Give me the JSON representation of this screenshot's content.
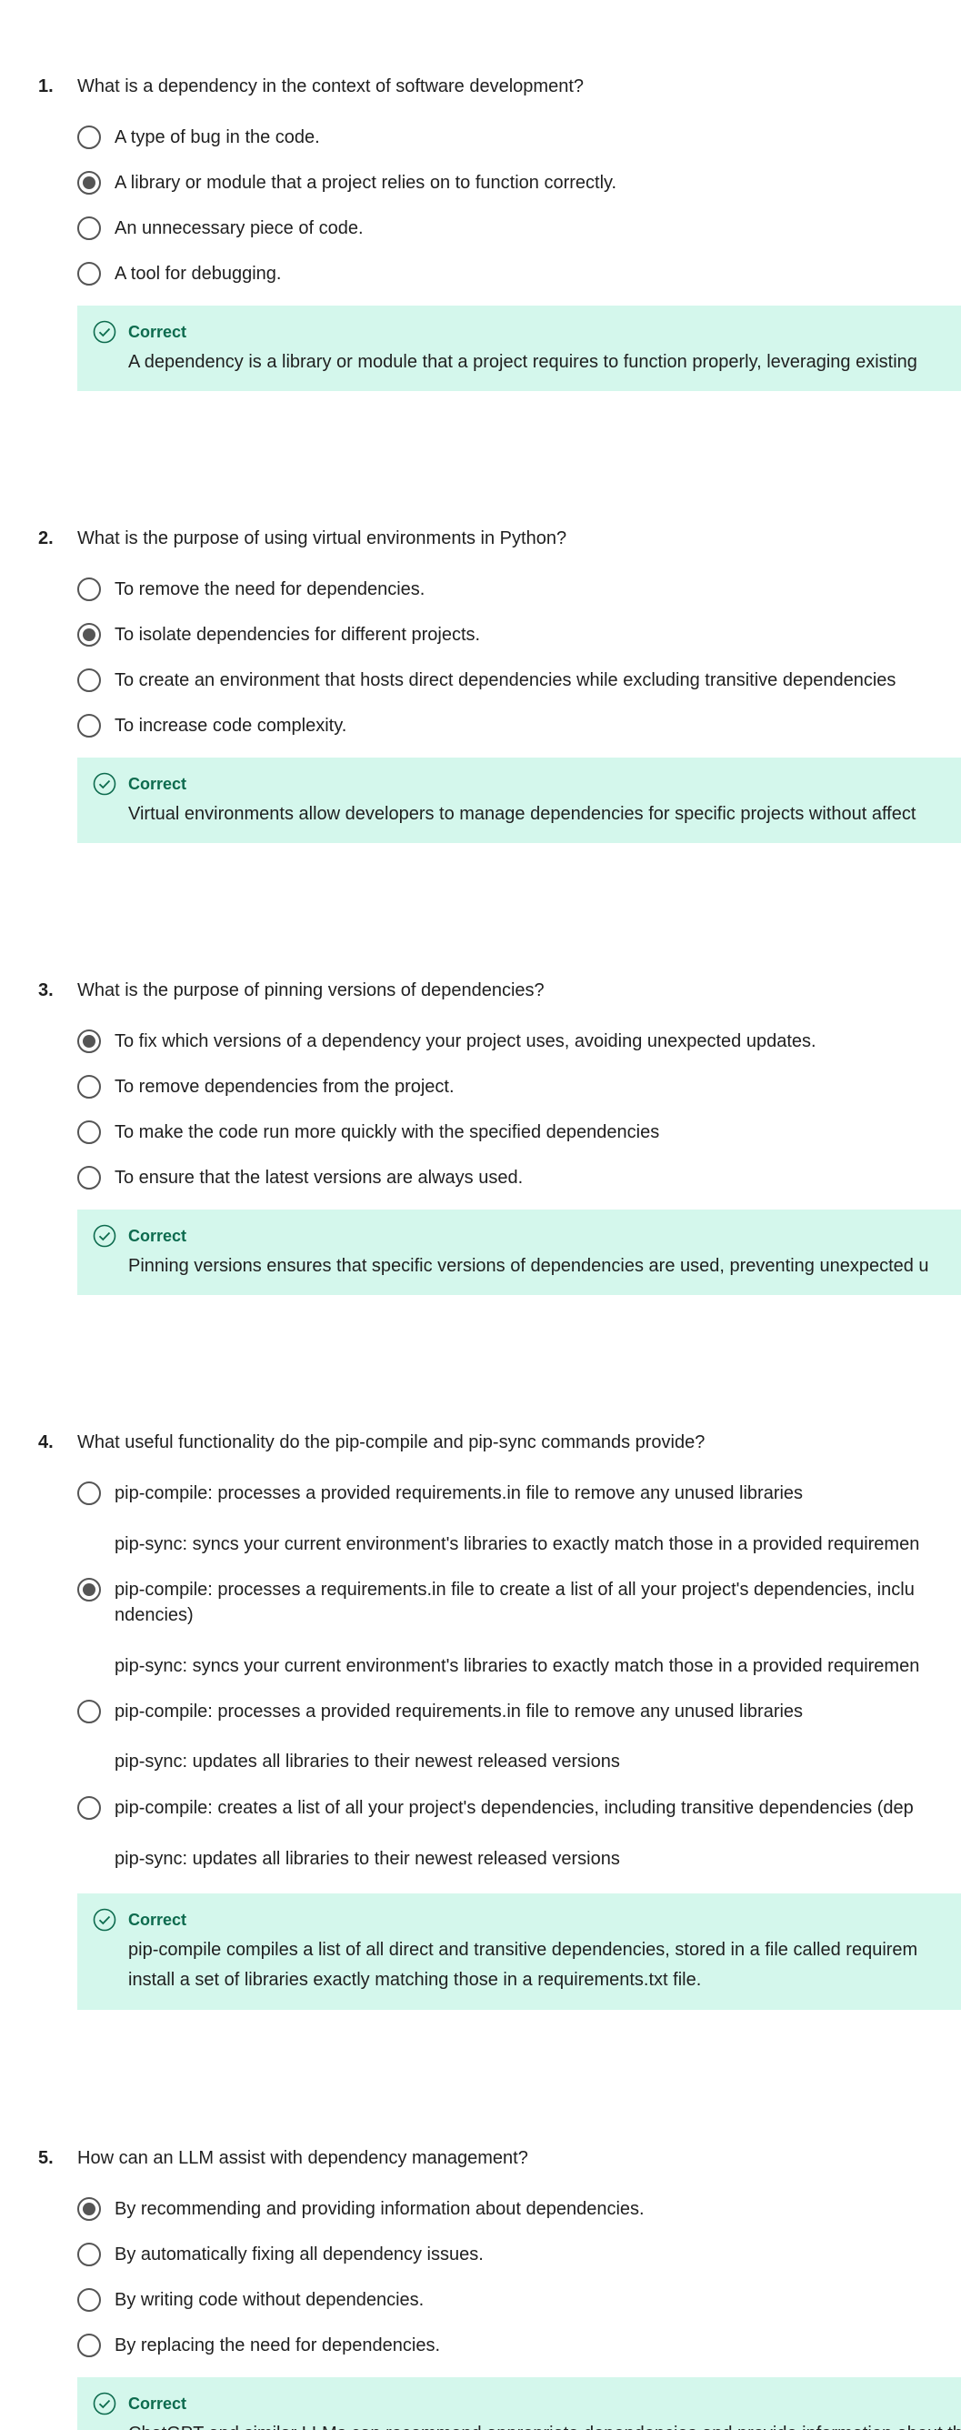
{
  "colors": {
    "feedback_bg": "#d4f7ec",
    "correct_text": "#0d6b4e",
    "radio_border": "#555555"
  },
  "questions": [
    {
      "number": "1.",
      "text": "What is a dependency in the context of software development?",
      "options": [
        {
          "label": "A type of bug in the code.",
          "selected": false
        },
        {
          "label": "A library or module that a project relies on to function correctly.",
          "selected": true
        },
        {
          "label": "An unnecessary piece of code.",
          "selected": false
        },
        {
          "label": "A tool for debugging.",
          "selected": false
        }
      ],
      "feedback": {
        "status": "Correct",
        "text": "A dependency is a library or module that a project requires to function properly, leveraging existing"
      }
    },
    {
      "number": "2.",
      "text": "What is the purpose of using virtual environments in Python?",
      "options": [
        {
          "label": "To remove the need for dependencies.",
          "selected": false
        },
        {
          "label": "To isolate dependencies for different projects.",
          "selected": true
        },
        {
          "label": "To create an environment that hosts direct dependencies while excluding transitive dependencies",
          "selected": false
        },
        {
          "label": "To increase code complexity.",
          "selected": false
        }
      ],
      "feedback": {
        "status": "Correct",
        "text": "Virtual environments allow developers to manage dependencies for specific projects without affect"
      }
    },
    {
      "number": "3.",
      "text": "What is the purpose of pinning versions of dependencies?",
      "options": [
        {
          "label": "To fix which versions of a dependency your project uses, avoiding unexpected updates.",
          "selected": true
        },
        {
          "label": "To remove dependencies from the project.",
          "selected": false
        },
        {
          "label": "To make the code run more quickly with the specified dependencies",
          "selected": false
        },
        {
          "label": "To ensure that the latest versions are always used.",
          "selected": false
        }
      ],
      "feedback": {
        "status": "Correct",
        "text": "Pinning versions ensures that specific versions of dependencies are used, preventing unexpected u"
      }
    },
    {
      "number": "4.",
      "text": "What useful functionality do the pip-compile and pip-sync commands provide?",
      "options": [
        {
          "label": "pip-compile: processes a provided requirements.in file to remove any unused libraries",
          "sub": "pip-sync: syncs your current environment's libraries to exactly match those in a provided requiremen",
          "selected": false
        },
        {
          "label": "pip-compile: processes a requirements.in file to create a list of  all your project's dependencies, inclu",
          "label2": "ndencies)",
          "sub": "pip-sync: syncs your current environment's libraries to exactly match those in a provided requiremen",
          "selected": true
        },
        {
          "label": "pip-compile: processes a provided requirements.in file to remove any unused libraries",
          "sub": "pip-sync: updates all libraries to their newest released versions",
          "selected": false
        },
        {
          "label": "pip-compile: creates a list of  all your project's dependencies, including transitive dependencies (dep",
          "sub": "pip-sync: updates all libraries to their newest released versions",
          "selected": false
        }
      ],
      "feedback": {
        "status": "Correct",
        "text": "pip-compile compiles a list of all direct and transitive dependencies, stored in a file called requirem",
        "text2": "install a set of libraries exactly matching those in a requirements.txt file."
      }
    },
    {
      "number": "5.",
      "text": "How can an LLM assist with dependency management?",
      "options": [
        {
          "label": "By recommending and providing information about dependencies.",
          "selected": true
        },
        {
          "label": "By automatically fixing all dependency issues.",
          "selected": false
        },
        {
          "label": "By writing code without dependencies.",
          "selected": false
        },
        {
          "label": "By replacing the need for dependencies.",
          "selected": false
        }
      ],
      "feedback": {
        "status": "Correct",
        "text": "ChatGPT and similar LLMs can recommend appropriate dependencies and provide information about th"
      }
    }
  ]
}
